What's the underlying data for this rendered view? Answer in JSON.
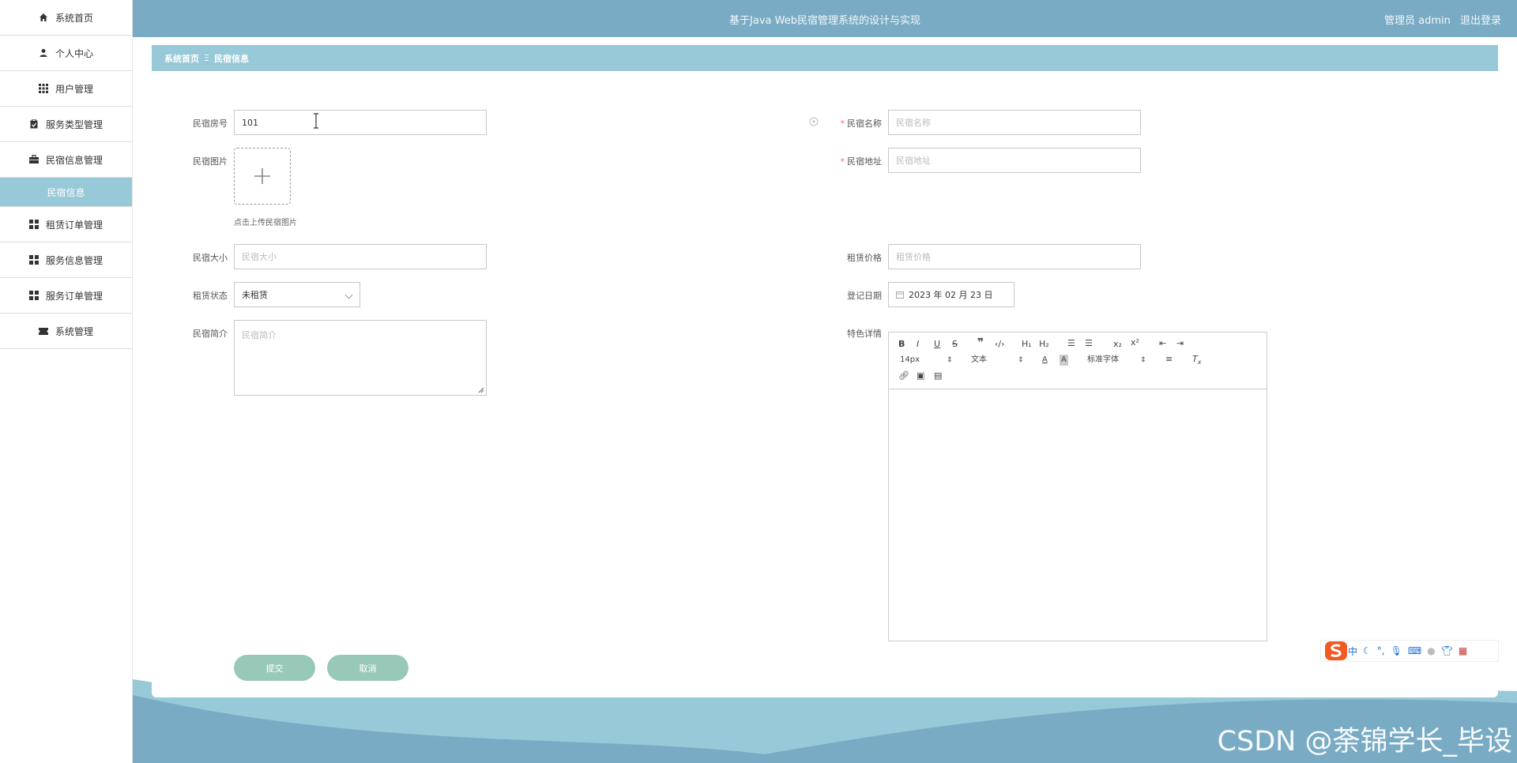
{
  "header": {
    "title": "基于Java Web民宿管理系统的设计与实现",
    "user": "管理员 admin",
    "logout": "退出登录"
  },
  "sidebar": {
    "items": [
      {
        "label": "系统首页",
        "icon": "home-icon"
      },
      {
        "label": "个人中心",
        "icon": "user-icon"
      },
      {
        "label": "用户管理",
        "icon": "grid-icon"
      },
      {
        "label": "服务类型管理",
        "icon": "clipboard-icon"
      },
      {
        "label": "民宿信息管理",
        "icon": "briefcase-icon"
      },
      {
        "label": "民宿信息",
        "icon": "",
        "active": true
      },
      {
        "label": "租赁订单管理",
        "icon": "grid4-icon"
      },
      {
        "label": "服务信息管理",
        "icon": "grid4-icon"
      },
      {
        "label": "服务订单管理",
        "icon": "grid4-icon"
      },
      {
        "label": "系统管理",
        "icon": "ticket-icon"
      }
    ]
  },
  "breadcrumb": {
    "home": "系统首页",
    "separator": "Ξ",
    "current": "民宿信息"
  },
  "form": {
    "room_no": {
      "label": "民宿房号",
      "value": "101"
    },
    "name": {
      "label": "民宿名称",
      "placeholder": "民宿名称",
      "required": true
    },
    "image": {
      "label": "民宿图片",
      "hint": "点击上传民宿图片"
    },
    "address": {
      "label": "民宿地址",
      "placeholder": "民宿地址",
      "required": true
    },
    "size": {
      "label": "民宿大小",
      "placeholder": "民宿大小"
    },
    "price": {
      "label": "租赁价格",
      "placeholder": "租赁价格"
    },
    "status": {
      "label": "租赁状态",
      "value": "未租赁"
    },
    "date": {
      "label": "登记日期",
      "value": "2023 年 02 月 23 日"
    },
    "intro": {
      "label": "民宿简介",
      "placeholder": "民宿简介"
    },
    "details": {
      "label": "特色详情"
    }
  },
  "editor": {
    "font_size": "14px",
    "text_type": "文本",
    "font_family": "标准字体",
    "bold": "B",
    "italic": "I",
    "underline": "U",
    "strike": "S",
    "h1": "H₁",
    "h2": "H₂",
    "sub": "x₂",
    "sup": "x²"
  },
  "buttons": {
    "submit": "提交",
    "cancel": "取消"
  },
  "ime": {
    "lang": "中"
  },
  "watermark": "CSDN @荼锦学长_毕设",
  "colors": {
    "header": "#79abc4",
    "accent": "#98c9d8",
    "button": "#98c9b8"
  }
}
